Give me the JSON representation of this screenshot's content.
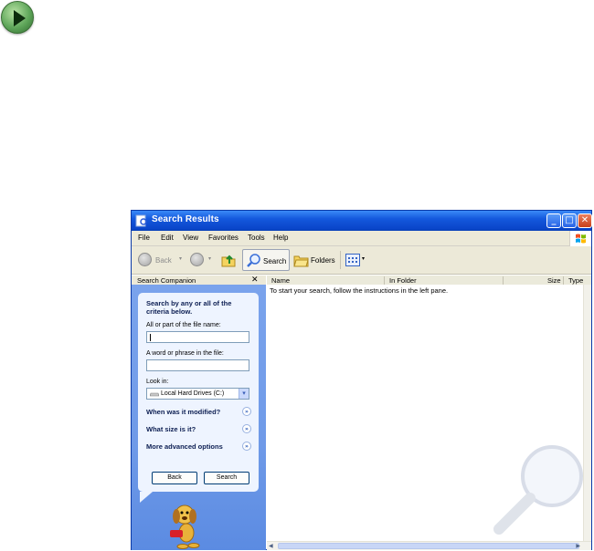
{
  "window": {
    "title": "Search Results"
  },
  "menu": [
    "File",
    "Edit",
    "View",
    "Favorites",
    "Tools",
    "Help"
  ],
  "toolbar": {
    "back": "Back",
    "search": "Search",
    "folders": "Folders"
  },
  "columns": [
    "Name",
    "In Folder",
    "Size",
    "Type"
  ],
  "companion": {
    "title": "Search Companion",
    "heading_line1": "Search by any or all of the",
    "heading_line2": "criteria below.",
    "filename_label": "All or part of the file name:",
    "filename_value": "",
    "phrase_label": "A word or phrase in the file:",
    "phrase_value": "",
    "lookin_label": "Look in:",
    "lookin_value": "Local Hard Drives (C:)",
    "when_modified": "When was it modified?",
    "what_size": "What size is it?",
    "advanced": "More advanced options",
    "back_button": "Back",
    "search_button": "Search"
  },
  "results": {
    "message": "To start your search, follow the instructions in the left pane."
  },
  "colors": {
    "title_bar": "#0a45c9",
    "companion_bg": "#6f9ae8",
    "accent": "#3aa04a"
  }
}
